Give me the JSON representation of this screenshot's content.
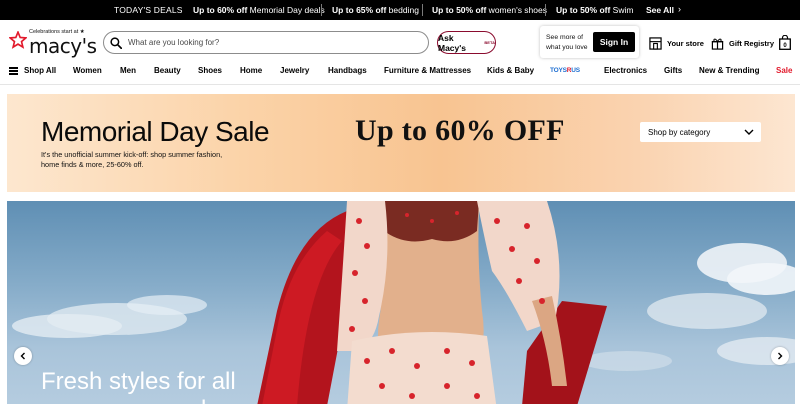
{
  "promo_bar": {
    "label": "TODAY'S DEALS",
    "deals": [
      {
        "bold": "Up to 60% off",
        "rest": " Memorial Day deals"
      },
      {
        "bold": "Up to 65% off",
        "rest": " bedding"
      },
      {
        "bold": "Up to 50% off",
        "rest": " women's shoes"
      },
      {
        "bold": "Up to 50% off",
        "rest": " Swim"
      }
    ],
    "see_all": "See All",
    "chevron": "›"
  },
  "header": {
    "logo_tagline": "Celebrations start at ★",
    "logo_word": "macy's",
    "search_placeholder": "What are you looking for?",
    "ask_label": "Ask Macy's",
    "ask_badge": "BETA",
    "signin_prompt_line1": "See more of",
    "signin_prompt_line2": "what you love",
    "signin_button": "Sign In",
    "your_store": "Your store",
    "gift_registry": "Gift Registry",
    "bag_count": "0"
  },
  "nav": {
    "shop_all": "Shop All",
    "items": [
      "Women",
      "Men",
      "Beauty",
      "Shoes",
      "Home",
      "Jewelry",
      "Handbags",
      "Furniture & Mattresses",
      "Kids & Baby",
      "TOYS R US",
      "Electronics",
      "Gifts",
      "New & Trending",
      "Sale"
    ]
  },
  "banner": {
    "title": "Memorial Day Sale",
    "percent": "Up to 60% OFF",
    "sub_line1": "It's the unofficial summer kick-off: shop summer fashion,",
    "sub_line2": "home finds & more, 25-60% off.",
    "shop_by": "Shop by category"
  },
  "hero": {
    "headline_line1": "Fresh styles for all",
    "headline_line2": "your summer plans"
  },
  "colors": {
    "brand_red": "#e21a2c",
    "ask_border": "#8a0b2e",
    "banner_peach": "#f8c491"
  }
}
